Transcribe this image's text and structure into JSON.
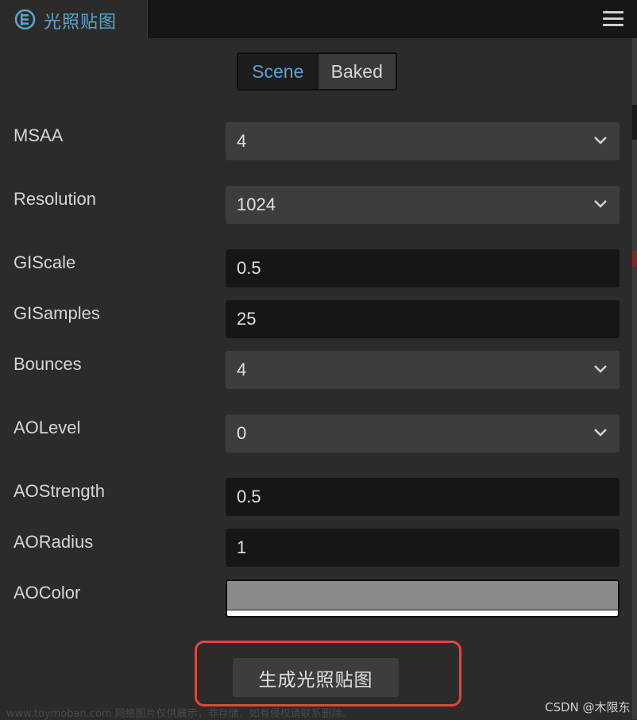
{
  "panel": {
    "tab_title": "光照贴图",
    "tab_icon": "lightmap-icon",
    "menu_icon": "hamburger-menu-icon"
  },
  "mode_toggle": {
    "options": [
      "Scene",
      "Baked"
    ],
    "selected": "Scene"
  },
  "settings": {
    "msaa": {
      "label": "MSAA",
      "value": "4"
    },
    "resolution": {
      "label": "Resolution",
      "value": "1024"
    },
    "gi_scale": {
      "label": "GIScale",
      "value": "0.5"
    },
    "gi_samples": {
      "label": "GISamples",
      "value": "25"
    },
    "bounces": {
      "label": "Bounces",
      "value": "4"
    },
    "ao_level": {
      "label": "AOLevel",
      "value": "0"
    },
    "ao_strength": {
      "label": "AOStrength",
      "value": "0.5"
    },
    "ao_radius": {
      "label": "AORadius",
      "value": "1"
    },
    "ao_color": {
      "label": "AOColor",
      "value": "#8a8a8a"
    }
  },
  "generate_button": {
    "label": "生成光照贴图",
    "highlight_color": "#e1483a"
  },
  "watermarks": {
    "left": "www.toymoban.com 网络图片仅供展示，非存储，如有侵权请联系删除。",
    "right": "CSDN @木限东"
  },
  "colors": {
    "accent": "#5aa6cf",
    "background": "#2b2b2b"
  }
}
